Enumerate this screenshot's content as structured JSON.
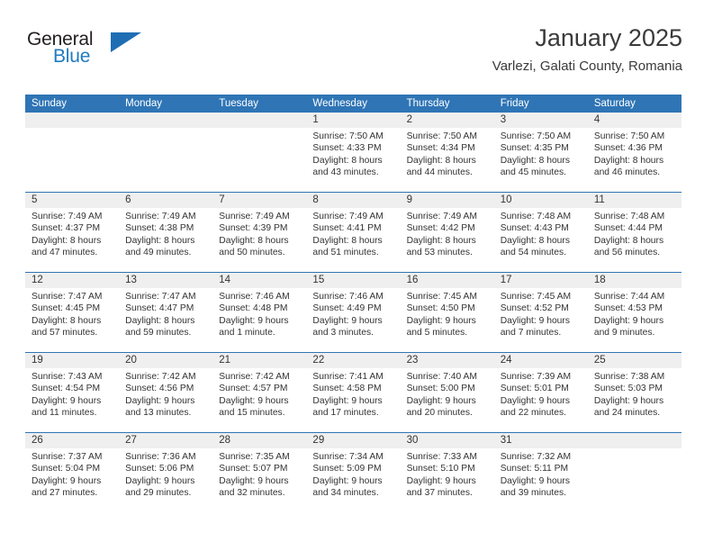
{
  "logo": {
    "line1": "General",
    "line2": "Blue",
    "triangle_icon": "triangle-icon",
    "color_text": "#231f20",
    "color_blue": "#1f7bc1"
  },
  "header": {
    "title": "January 2025",
    "location": "Varlezi, Galati County, Romania"
  },
  "colors": {
    "header_blue": "#2f75b5",
    "day_band_gray": "#efefef",
    "text": "#333333"
  },
  "calendar": {
    "weekday_headers": [
      "Sunday",
      "Monday",
      "Tuesday",
      "Wednesday",
      "Thursday",
      "Friday",
      "Saturday"
    ],
    "weeks": [
      [
        {
          "day": "",
          "sunrise": "",
          "sunset": "",
          "daylight1": "",
          "daylight2": ""
        },
        {
          "day": "",
          "sunrise": "",
          "sunset": "",
          "daylight1": "",
          "daylight2": ""
        },
        {
          "day": "",
          "sunrise": "",
          "sunset": "",
          "daylight1": "",
          "daylight2": ""
        },
        {
          "day": "1",
          "sunrise": "Sunrise: 7:50 AM",
          "sunset": "Sunset: 4:33 PM",
          "daylight1": "Daylight: 8 hours",
          "daylight2": "and 43 minutes."
        },
        {
          "day": "2",
          "sunrise": "Sunrise: 7:50 AM",
          "sunset": "Sunset: 4:34 PM",
          "daylight1": "Daylight: 8 hours",
          "daylight2": "and 44 minutes."
        },
        {
          "day": "3",
          "sunrise": "Sunrise: 7:50 AM",
          "sunset": "Sunset: 4:35 PM",
          "daylight1": "Daylight: 8 hours",
          "daylight2": "and 45 minutes."
        },
        {
          "day": "4",
          "sunrise": "Sunrise: 7:50 AM",
          "sunset": "Sunset: 4:36 PM",
          "daylight1": "Daylight: 8 hours",
          "daylight2": "and 46 minutes."
        }
      ],
      [
        {
          "day": "5",
          "sunrise": "Sunrise: 7:49 AM",
          "sunset": "Sunset: 4:37 PM",
          "daylight1": "Daylight: 8 hours",
          "daylight2": "and 47 minutes."
        },
        {
          "day": "6",
          "sunrise": "Sunrise: 7:49 AM",
          "sunset": "Sunset: 4:38 PM",
          "daylight1": "Daylight: 8 hours",
          "daylight2": "and 49 minutes."
        },
        {
          "day": "7",
          "sunrise": "Sunrise: 7:49 AM",
          "sunset": "Sunset: 4:39 PM",
          "daylight1": "Daylight: 8 hours",
          "daylight2": "and 50 minutes."
        },
        {
          "day": "8",
          "sunrise": "Sunrise: 7:49 AM",
          "sunset": "Sunset: 4:41 PM",
          "daylight1": "Daylight: 8 hours",
          "daylight2": "and 51 minutes."
        },
        {
          "day": "9",
          "sunrise": "Sunrise: 7:49 AM",
          "sunset": "Sunset: 4:42 PM",
          "daylight1": "Daylight: 8 hours",
          "daylight2": "and 53 minutes."
        },
        {
          "day": "10",
          "sunrise": "Sunrise: 7:48 AM",
          "sunset": "Sunset: 4:43 PM",
          "daylight1": "Daylight: 8 hours",
          "daylight2": "and 54 minutes."
        },
        {
          "day": "11",
          "sunrise": "Sunrise: 7:48 AM",
          "sunset": "Sunset: 4:44 PM",
          "daylight1": "Daylight: 8 hours",
          "daylight2": "and 56 minutes."
        }
      ],
      [
        {
          "day": "12",
          "sunrise": "Sunrise: 7:47 AM",
          "sunset": "Sunset: 4:45 PM",
          "daylight1": "Daylight: 8 hours",
          "daylight2": "and 57 minutes."
        },
        {
          "day": "13",
          "sunrise": "Sunrise: 7:47 AM",
          "sunset": "Sunset: 4:47 PM",
          "daylight1": "Daylight: 8 hours",
          "daylight2": "and 59 minutes."
        },
        {
          "day": "14",
          "sunrise": "Sunrise: 7:46 AM",
          "sunset": "Sunset: 4:48 PM",
          "daylight1": "Daylight: 9 hours",
          "daylight2": "and 1 minute."
        },
        {
          "day": "15",
          "sunrise": "Sunrise: 7:46 AM",
          "sunset": "Sunset: 4:49 PM",
          "daylight1": "Daylight: 9 hours",
          "daylight2": "and 3 minutes."
        },
        {
          "day": "16",
          "sunrise": "Sunrise: 7:45 AM",
          "sunset": "Sunset: 4:50 PM",
          "daylight1": "Daylight: 9 hours",
          "daylight2": "and 5 minutes."
        },
        {
          "day": "17",
          "sunrise": "Sunrise: 7:45 AM",
          "sunset": "Sunset: 4:52 PM",
          "daylight1": "Daylight: 9 hours",
          "daylight2": "and 7 minutes."
        },
        {
          "day": "18",
          "sunrise": "Sunrise: 7:44 AM",
          "sunset": "Sunset: 4:53 PM",
          "daylight1": "Daylight: 9 hours",
          "daylight2": "and 9 minutes."
        }
      ],
      [
        {
          "day": "19",
          "sunrise": "Sunrise: 7:43 AM",
          "sunset": "Sunset: 4:54 PM",
          "daylight1": "Daylight: 9 hours",
          "daylight2": "and 11 minutes."
        },
        {
          "day": "20",
          "sunrise": "Sunrise: 7:42 AM",
          "sunset": "Sunset: 4:56 PM",
          "daylight1": "Daylight: 9 hours",
          "daylight2": "and 13 minutes."
        },
        {
          "day": "21",
          "sunrise": "Sunrise: 7:42 AM",
          "sunset": "Sunset: 4:57 PM",
          "daylight1": "Daylight: 9 hours",
          "daylight2": "and 15 minutes."
        },
        {
          "day": "22",
          "sunrise": "Sunrise: 7:41 AM",
          "sunset": "Sunset: 4:58 PM",
          "daylight1": "Daylight: 9 hours",
          "daylight2": "and 17 minutes."
        },
        {
          "day": "23",
          "sunrise": "Sunrise: 7:40 AM",
          "sunset": "Sunset: 5:00 PM",
          "daylight1": "Daylight: 9 hours",
          "daylight2": "and 20 minutes."
        },
        {
          "day": "24",
          "sunrise": "Sunrise: 7:39 AM",
          "sunset": "Sunset: 5:01 PM",
          "daylight1": "Daylight: 9 hours",
          "daylight2": "and 22 minutes."
        },
        {
          "day": "25",
          "sunrise": "Sunrise: 7:38 AM",
          "sunset": "Sunset: 5:03 PM",
          "daylight1": "Daylight: 9 hours",
          "daylight2": "and 24 minutes."
        }
      ],
      [
        {
          "day": "26",
          "sunrise": "Sunrise: 7:37 AM",
          "sunset": "Sunset: 5:04 PM",
          "daylight1": "Daylight: 9 hours",
          "daylight2": "and 27 minutes."
        },
        {
          "day": "27",
          "sunrise": "Sunrise: 7:36 AM",
          "sunset": "Sunset: 5:06 PM",
          "daylight1": "Daylight: 9 hours",
          "daylight2": "and 29 minutes."
        },
        {
          "day": "28",
          "sunrise": "Sunrise: 7:35 AM",
          "sunset": "Sunset: 5:07 PM",
          "daylight1": "Daylight: 9 hours",
          "daylight2": "and 32 minutes."
        },
        {
          "day": "29",
          "sunrise": "Sunrise: 7:34 AM",
          "sunset": "Sunset: 5:09 PM",
          "daylight1": "Daylight: 9 hours",
          "daylight2": "and 34 minutes."
        },
        {
          "day": "30",
          "sunrise": "Sunrise: 7:33 AM",
          "sunset": "Sunset: 5:10 PM",
          "daylight1": "Daylight: 9 hours",
          "daylight2": "and 37 minutes."
        },
        {
          "day": "31",
          "sunrise": "Sunrise: 7:32 AM",
          "sunset": "Sunset: 5:11 PM",
          "daylight1": "Daylight: 9 hours",
          "daylight2": "and 39 minutes."
        },
        {
          "day": "",
          "sunrise": "",
          "sunset": "",
          "daylight1": "",
          "daylight2": ""
        }
      ]
    ]
  }
}
